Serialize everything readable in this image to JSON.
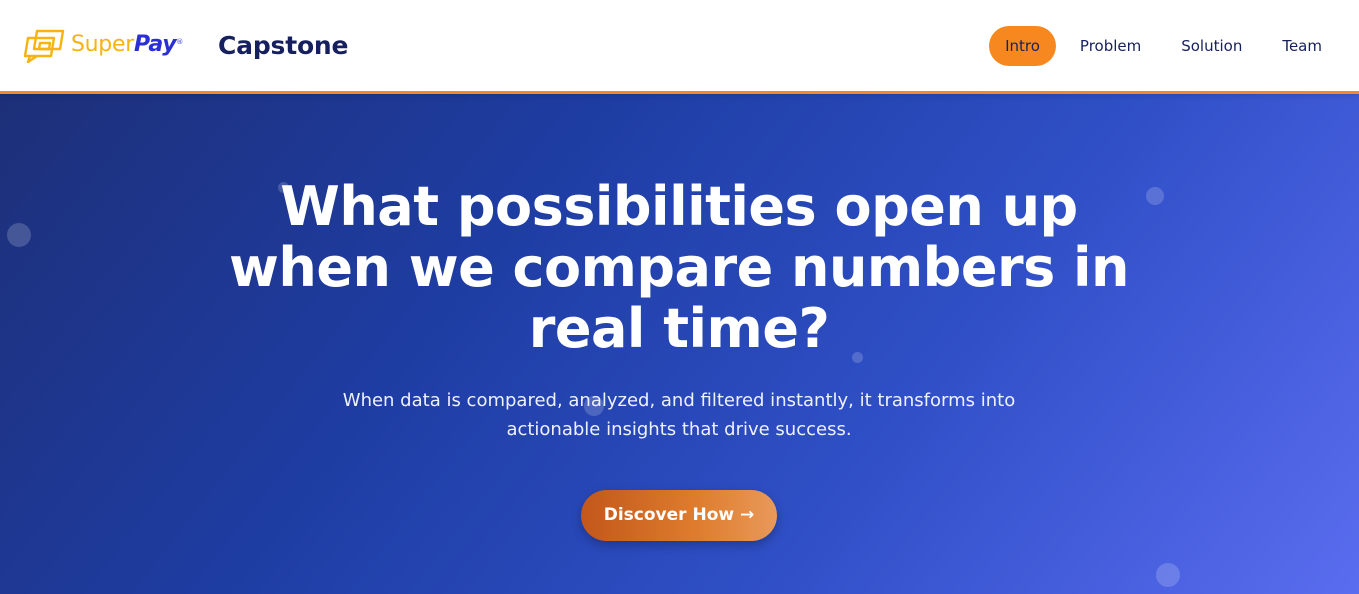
{
  "brand": {
    "name_part1": "Super",
    "name_part2": "Pay",
    "registered_mark": "®",
    "logo_icon": "superpay-logo-icon",
    "color_primary": "#f7b312",
    "color_secondary": "#2b2fd6"
  },
  "header": {
    "app_title": "Capstone",
    "accent_color": "#f28a25"
  },
  "nav": {
    "items": [
      {
        "label": "Intro",
        "active": true
      },
      {
        "label": "Problem",
        "active": false
      },
      {
        "label": "Solution",
        "active": false
      },
      {
        "label": "Team",
        "active": false
      }
    ]
  },
  "hero": {
    "title": "What possibilities open up when we compare numbers in real time?",
    "subtitle": "When data is compared, analyzed, and filtered instantly, it transforms into actionable insights that drive success.",
    "cta_label": "Discover How →",
    "gradient_start": "#1d2f78",
    "gradient_end": "#5a6cf0",
    "cta_color": "#d8702a"
  }
}
